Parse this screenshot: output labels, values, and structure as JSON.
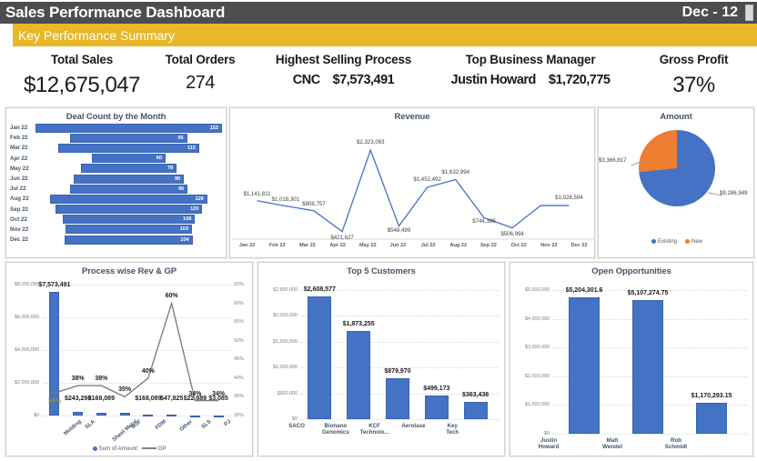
{
  "header": {
    "app_title": "Sales Performance Dashboard",
    "period": "Dec - 12",
    "section_title": "Key Performance Summary"
  },
  "kpis": [
    {
      "label": "Total Sales",
      "value": "$12,675,047"
    },
    {
      "label": "Total Orders",
      "value": "274"
    },
    {
      "label": "Highest Selling Process",
      "value": "CNC",
      "value2": "$7,573,491"
    },
    {
      "label": "Top Business Manager",
      "value": "Justin Howard",
      "value2": "$1,720,775"
    },
    {
      "label": "Gross Profit",
      "value": "37%"
    }
  ],
  "colors": {
    "header_bg": "#4d4d4d",
    "accent_yellow": "#e8b827",
    "series_blue": "#4472c4",
    "series_orange": "#ed7d31",
    "gp_line": "#808080"
  },
  "chart_data": [
    {
      "type": "bar",
      "id": "deal-count",
      "title": "Deal Count by the Month",
      "orientation": "funnel-centered",
      "categories": [
        "Jan 22",
        "Feb 22",
        "Mar 22",
        "Apr 22",
        "May 22",
        "Jun 22",
        "Jul 22",
        "Aug 22",
        "Sep 22",
        "Oct 22",
        "Nov 22",
        "Dec 22"
      ],
      "values": [
        152,
        95,
        115,
        60,
        78,
        90,
        96,
        128,
        120,
        108,
        103,
        104
      ],
      "xlabel": "",
      "ylabel": "",
      "grid": false,
      "legend": "none"
    },
    {
      "type": "line",
      "id": "revenue",
      "title": "Revenue",
      "categories": [
        "Jan 22",
        "Feb 22",
        "Mar 22",
        "Apr 22",
        "May 22",
        "Jun 22",
        "Jul 22",
        "Aug 22",
        "Sep 22",
        "Oct 22",
        "Nov 22",
        "Dec 22"
      ],
      "values": [
        1141811,
        1018301,
        908757,
        421627,
        2323093,
        548499,
        1452492,
        1632994,
        744388,
        506994,
        1028594,
        1028594
      ],
      "data_labels": [
        "$1,141,811",
        "$1,018,301",
        "$908,757",
        "$421,627",
        "$2,323,093",
        "$548,499",
        "$1,452,492",
        "$1,632,994",
        "$744,388",
        "$506,994",
        "",
        "$1,028,594"
      ],
      "xlabel": "",
      "ylabel": "",
      "grid": false,
      "legend": "none"
    },
    {
      "type": "pie",
      "id": "amount",
      "title": "Amount",
      "labels": [
        "Existing",
        "New"
      ],
      "values": [
        9286949,
        3366817
      ],
      "data_labels": [
        "$9,286,949",
        "$3,366,817"
      ],
      "legend": "bottom"
    },
    {
      "type": "bar",
      "id": "process-rev-gp",
      "title": "Process wise Rev & GP",
      "categories": [
        "Molding",
        "SLA",
        "Sheet Metal",
        "MJF",
        "FDM",
        "Other",
        "SLS",
        "PJ"
      ],
      "series": [
        {
          "name": "Sum of Amount",
          "type": "bar",
          "values": [
            7573491,
            243298,
            168089,
            168089,
            47825,
            47825,
            22889,
            3085
          ],
          "data_labels": [
            "$7,573,491",
            "$243,298",
            "$168,089",
            "",
            "$168,089",
            "$47,825",
            "$22,889",
            "$3,085"
          ]
        },
        {
          "name": "GP",
          "type": "line",
          "axis": "right",
          "values": [
            36,
            38,
            38,
            35,
            40,
            60,
            34,
            34
          ],
          "data_labels": [
            "36%",
            "38%",
            "38%",
            "35%",
            "40%",
            "60%",
            "34%",
            "34%"
          ]
        }
      ],
      "ylabel": "",
      "ylim": [
        0,
        8000000
      ],
      "yticks": [
        "$0",
        "$2,000,000",
        "$4,000,000",
        "$6,000,000",
        "$8,000,000"
      ],
      "y2lim": [
        30,
        65
      ],
      "y2ticks": [
        "30%",
        "35%",
        "40%",
        "45%",
        "50%",
        "55%",
        "60%",
        "65%"
      ],
      "grid": true,
      "legend": "bottom"
    },
    {
      "type": "bar",
      "id": "top-5-customers",
      "title": "Top 5 Customers",
      "categories": [
        "SACO",
        "Bionano Genomics",
        "KCF Technolo...",
        "Aerolase",
        "Key Tech"
      ],
      "values": [
        2608577,
        1873255,
        879970,
        499173,
        363438
      ],
      "data_labels": [
        "$2,608,577",
        "$1,873,255",
        "$879,970",
        "$499,173",
        "$363,438"
      ],
      "ylim": [
        0,
        2750000
      ],
      "yticks": [
        "$0",
        "$500,000",
        "$1,000,000",
        "$1,500,000",
        "$2,000,000",
        "$2,500,000"
      ],
      "grid": true,
      "legend": "none"
    },
    {
      "type": "bar",
      "id": "open-opportunities",
      "title": "Open Opportunities",
      "categories": [
        "Justin Howard",
        "Matt Wendel",
        "Rob Schmidt"
      ],
      "values": [
        5204301.6,
        5107274.75,
        1170293.15
      ],
      "data_labels": [
        "$5,204,301.6",
        "$5,107,274.75",
        "$1,170,293.15"
      ],
      "ylim": [
        0,
        5500000
      ],
      "yticks": [
        "$0",
        "$1,000,000",
        "$2,000,000",
        "$3,000,000",
        "$4,000,000",
        "$5,000,000"
      ],
      "grid": true,
      "legend": "none"
    }
  ]
}
